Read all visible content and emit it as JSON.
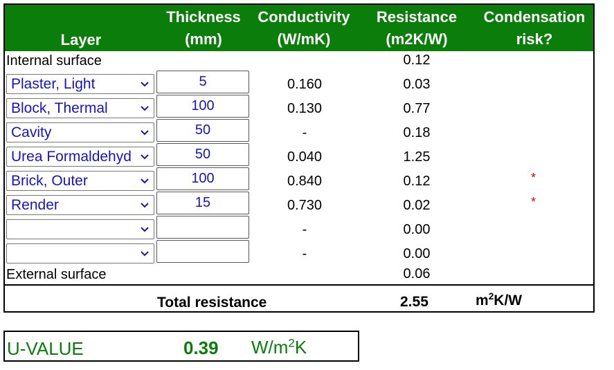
{
  "headers": {
    "layer": "Layer",
    "thickness_1": "Thickness",
    "thickness_2": "(mm)",
    "conductivity_1": "Conductivity",
    "conductivity_2": "(W/mK)",
    "resistance_1": "Resistance",
    "resistance_2": "(m2K/W)",
    "condensation_1": "Condensation",
    "condensation_2": "risk?"
  },
  "internal_surface": {
    "label": "Internal surface",
    "resistance": "0.12"
  },
  "layers": [
    {
      "material": "Plaster, Light",
      "thickness": "5",
      "conductivity": "0.160",
      "resistance": "0.03",
      "risk": ""
    },
    {
      "material": "Block, Thermal",
      "thickness": "100",
      "conductivity": "0.130",
      "resistance": "0.77",
      "risk": ""
    },
    {
      "material": "Cavity",
      "thickness": "50",
      "conductivity": "-",
      "resistance": "0.18",
      "risk": ""
    },
    {
      "material": "Urea Formaldehyd",
      "thickness": "50",
      "conductivity": "0.040",
      "resistance": "1.25",
      "risk": ""
    },
    {
      "material": "Brick, Outer",
      "thickness": "100",
      "conductivity": "0.840",
      "resistance": "0.12",
      "risk": "*"
    },
    {
      "material": "Render",
      "thickness": "15",
      "conductivity": "0.730",
      "resistance": "0.02",
      "risk": "*"
    },
    {
      "material": "",
      "thickness": "",
      "conductivity": "-",
      "resistance": "0.00",
      "risk": ""
    },
    {
      "material": "",
      "thickness": "",
      "conductivity": "-",
      "resistance": "0.00",
      "risk": ""
    }
  ],
  "external_surface": {
    "label": "External surface",
    "resistance": "0.06"
  },
  "total": {
    "label": "Total resistance",
    "value": "2.55",
    "unit_base": "m",
    "unit_sup": "2",
    "unit_rest": "K/W"
  },
  "u_value": {
    "label": "U-VALUE",
    "value": "0.39",
    "unit_base": "W/m",
    "unit_sup": "2",
    "unit_rest": "K"
  },
  "colors": {
    "header_bg": "#0a7d0a",
    "input_text": "#1414c8",
    "risk": "#e00000",
    "u_value_text": "#0a7d0a"
  },
  "icons": {
    "dropdown": "chevron-down-icon"
  }
}
